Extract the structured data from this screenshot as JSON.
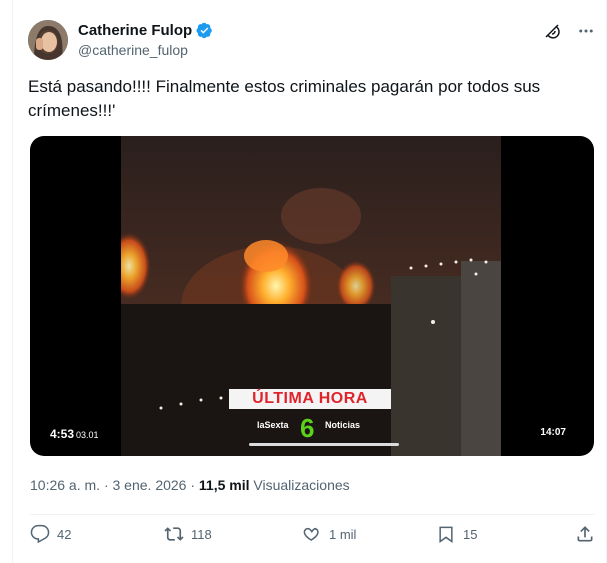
{
  "author": {
    "display_name": "Catherine Fulop",
    "handle": "@catherine_fulop",
    "verified_icon": "verified-badge-icon",
    "avatar_icon": "avatar"
  },
  "header_icons": [
    "grok-icon",
    "more-icon"
  ],
  "tweet": {
    "text": "Está pasando!!!! Finalmente estos criminales pagarán por todos sus crímenes!!!'"
  },
  "video": {
    "elapsed": "4:53",
    "elapsed_small": "03.01",
    "clock": "14:07",
    "banner": "ÚLTIMA HORA",
    "channel": "laSexta",
    "channel_number": "6",
    "program": "Noticias"
  },
  "meta": {
    "time": "10:26 a. m.",
    "separator": "·",
    "date": "3 ene. 2026",
    "views_count": "11,5 mil",
    "views_label": "Visualizaciones"
  },
  "actions": {
    "replies": "42",
    "reposts": "118",
    "likes": "1 mil",
    "bookmarks": "15"
  },
  "colors": {
    "accent": "#1d9bf0",
    "text": "#0f1419",
    "secondary": "#536471"
  }
}
